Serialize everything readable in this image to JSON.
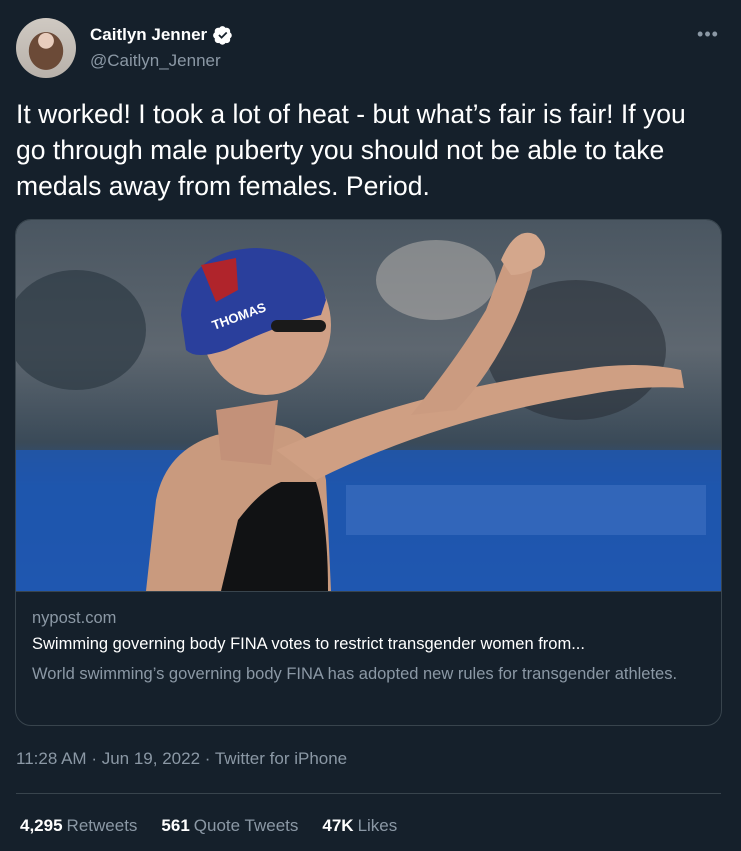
{
  "user": {
    "display_name": "Caitlyn Jenner",
    "handle": "@Caitlyn_Jenner",
    "verified": true
  },
  "tweet": {
    "text": "It worked! I took a lot of heat - but what’s fair is fair! If you go through male puberty you should not be able to take medals away from females. Period."
  },
  "card": {
    "domain": "nypost.com",
    "title": "Swimming governing body FINA votes to restrict transgender women from...",
    "description": "World swimming’s governing body FINA has adopted new rules for transgender athletes.",
    "image_cap_text": "THOMAS"
  },
  "meta": {
    "time": "11:28 AM",
    "separator": "·",
    "date": "Jun 19, 2022",
    "source": "Twitter for iPhone"
  },
  "stats": [
    {
      "count": "4,295",
      "label": "Retweets"
    },
    {
      "count": "561",
      "label": "Quote Tweets"
    },
    {
      "count": "47K",
      "label": "Likes"
    }
  ],
  "icons": {
    "verified": "verified-badge-icon",
    "more": "more-options-icon"
  },
  "colors": {
    "background": "#15202b",
    "text": "#ffffff",
    "secondary": "#8b98a5",
    "border": "#38444d"
  }
}
